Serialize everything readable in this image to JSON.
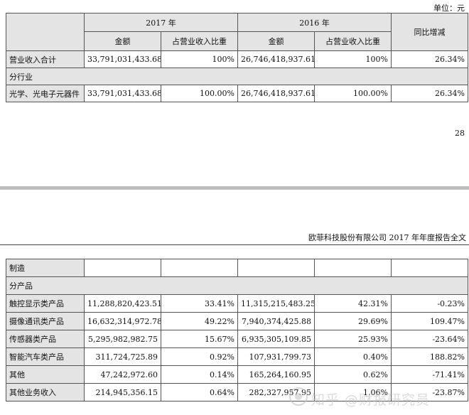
{
  "unit_label": "单位：元",
  "table1": {
    "year_2017": "2017 年",
    "year_2016": "2016 年",
    "yoy": "同比增减",
    "amount": "金额",
    "ratio": "占营业收入比重",
    "rows": [
      {
        "label": "营业收入合计",
        "a2017": "33,791,031,433.68",
        "r2017": "100%",
        "a2016": "26,746,418,937.61",
        "r2016": "100%",
        "yoy": "26.34%"
      },
      {
        "label": "分行业"
      },
      {
        "label": "光学、光电子元器件",
        "a2017": "33,791,031,433.68",
        "r2017": "100.00%",
        "a2016": "26,746,418,937.61",
        "r2016": "100.00%",
        "yoy": "26.34%"
      }
    ]
  },
  "page_number": "28",
  "running_header": "欧菲科技股份有限公司 2017 年年度报告全文",
  "table2": {
    "rows": [
      {
        "label": "制造"
      },
      {
        "label": "分产品"
      },
      {
        "label": "触控显示类产品",
        "a2017": "11,288,820,423.51",
        "r2017": "33.41%",
        "a2016": "11,315,215,483.25",
        "r2016": "42.31%",
        "yoy": "-0.23%"
      },
      {
        "label": "摄像通讯类产品",
        "a2017": "16,632,314,972.78",
        "r2017": "49.22%",
        "a2016": "7,940,374,425.88",
        "r2016": "29.69%",
        "yoy": "109.47%"
      },
      {
        "label": "传感器类产品",
        "a2017": "5,295,982,982.75",
        "r2017": "15.67%",
        "a2016": "6,935,305,109.85",
        "r2016": "25.93%",
        "yoy": "-23.64%"
      },
      {
        "label": "智能汽车类产品",
        "a2017": "311,724,725.89",
        "r2017": "0.92%",
        "a2016": "107,931,799.73",
        "r2016": "0.40%",
        "yoy": "188.82%"
      },
      {
        "label": "其他",
        "a2017": "47,242,972.60",
        "r2017": "0.14%",
        "a2016": "165,264,160.95",
        "r2016": "0.62%",
        "yoy": "-71.41%"
      },
      {
        "label": "其他业务收入",
        "a2017": "214,945,356.15",
        "r2017": "0.64%",
        "a2016": "282,327,957.95",
        "r2016": "1.06%",
        "yoy": "-23.87%"
      }
    ]
  },
  "watermark": "知乎 @财报研究员"
}
